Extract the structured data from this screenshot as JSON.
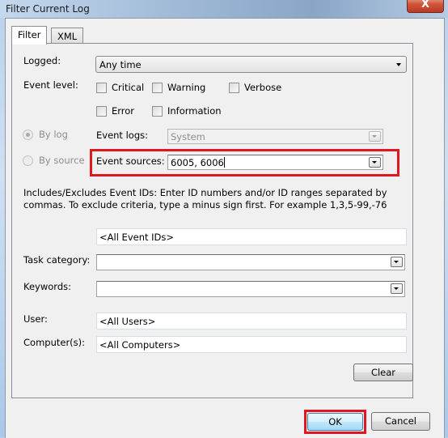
{
  "window": {
    "title": "Filter Current Log",
    "close_glyph": "X"
  },
  "tabs": [
    {
      "label": "Filter",
      "active": true
    },
    {
      "label": "XML",
      "active": false
    }
  ],
  "filter": {
    "logged": {
      "label": "Logged:",
      "value": "Any time"
    },
    "event_level": {
      "label": "Event level:",
      "options": [
        {
          "label": "Critical",
          "checked": false
        },
        {
          "label": "Warning",
          "checked": false
        },
        {
          "label": "Verbose",
          "checked": false
        },
        {
          "label": "Error",
          "checked": false
        },
        {
          "label": "Information",
          "checked": false
        }
      ]
    },
    "by_log": {
      "label": "By log",
      "selected": true,
      "enabled": false
    },
    "by_source": {
      "label": "By source",
      "selected": false,
      "enabled": false
    },
    "event_logs": {
      "label": "Event logs:",
      "value": "System"
    },
    "event_sources": {
      "label": "Event sources:",
      "value": "6005, 6006"
    },
    "help_text": "Includes/Excludes Event IDs: Enter ID numbers and/or ID ranges separated by commas. To exclude criteria, type a minus sign first. For example 1,3,5-99,-76",
    "event_ids": {
      "value": "<All Event IDs>"
    },
    "task_category": {
      "label": "Task category:",
      "value": ""
    },
    "keywords": {
      "label": "Keywords:",
      "value": ""
    },
    "user": {
      "label": "User:",
      "value": "<All Users>"
    },
    "computers": {
      "label": "Computer(s):",
      "value": "<All Computers>"
    },
    "clear_label": "Clear"
  },
  "footer": {
    "ok_label": "OK",
    "cancel_label": "Cancel"
  },
  "highlight_color": "#e0171f"
}
